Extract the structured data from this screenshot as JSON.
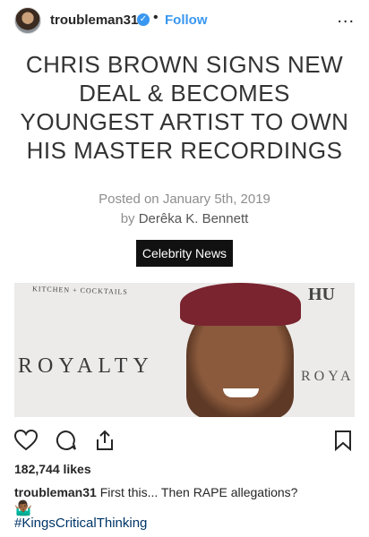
{
  "post_header": {
    "username": "troubleman31",
    "separator": "•",
    "follow_label": "Follow",
    "more_label": "..."
  },
  "article": {
    "headline": "CHRIS BROWN SIGNS NEW DEAL & BECOMES YOUNGEST ARTIST TO OWN HIS MASTER RECORDINGS",
    "posted_on": "Posted on January 5th, 2019",
    "byline_prefix": "by",
    "author": "Derêka K. Bennett",
    "category": "Celebrity News",
    "photo_text": {
      "kitchen": "KITCHEN + COCKTAILS",
      "royalty_big": "ROYALTY",
      "royalty_small": "ROYAL",
      "top_right": "HU"
    }
  },
  "engagement": {
    "likes": "182,744 likes"
  },
  "caption": {
    "username": "troubleman31",
    "text": "First this... Then RAPE allegations?",
    "emoji": "🤷🏾‍♂️",
    "hashtag": "#KingsCriticalThinking"
  },
  "icons": [
    "avatar",
    "verified-badge-icon",
    "more-options-icon",
    "heart-icon",
    "comment-icon",
    "share-icon",
    "bookmark-icon"
  ],
  "colors": {
    "link": "#3897f0",
    "hashtag": "#003569",
    "category_bg": "#111111"
  }
}
